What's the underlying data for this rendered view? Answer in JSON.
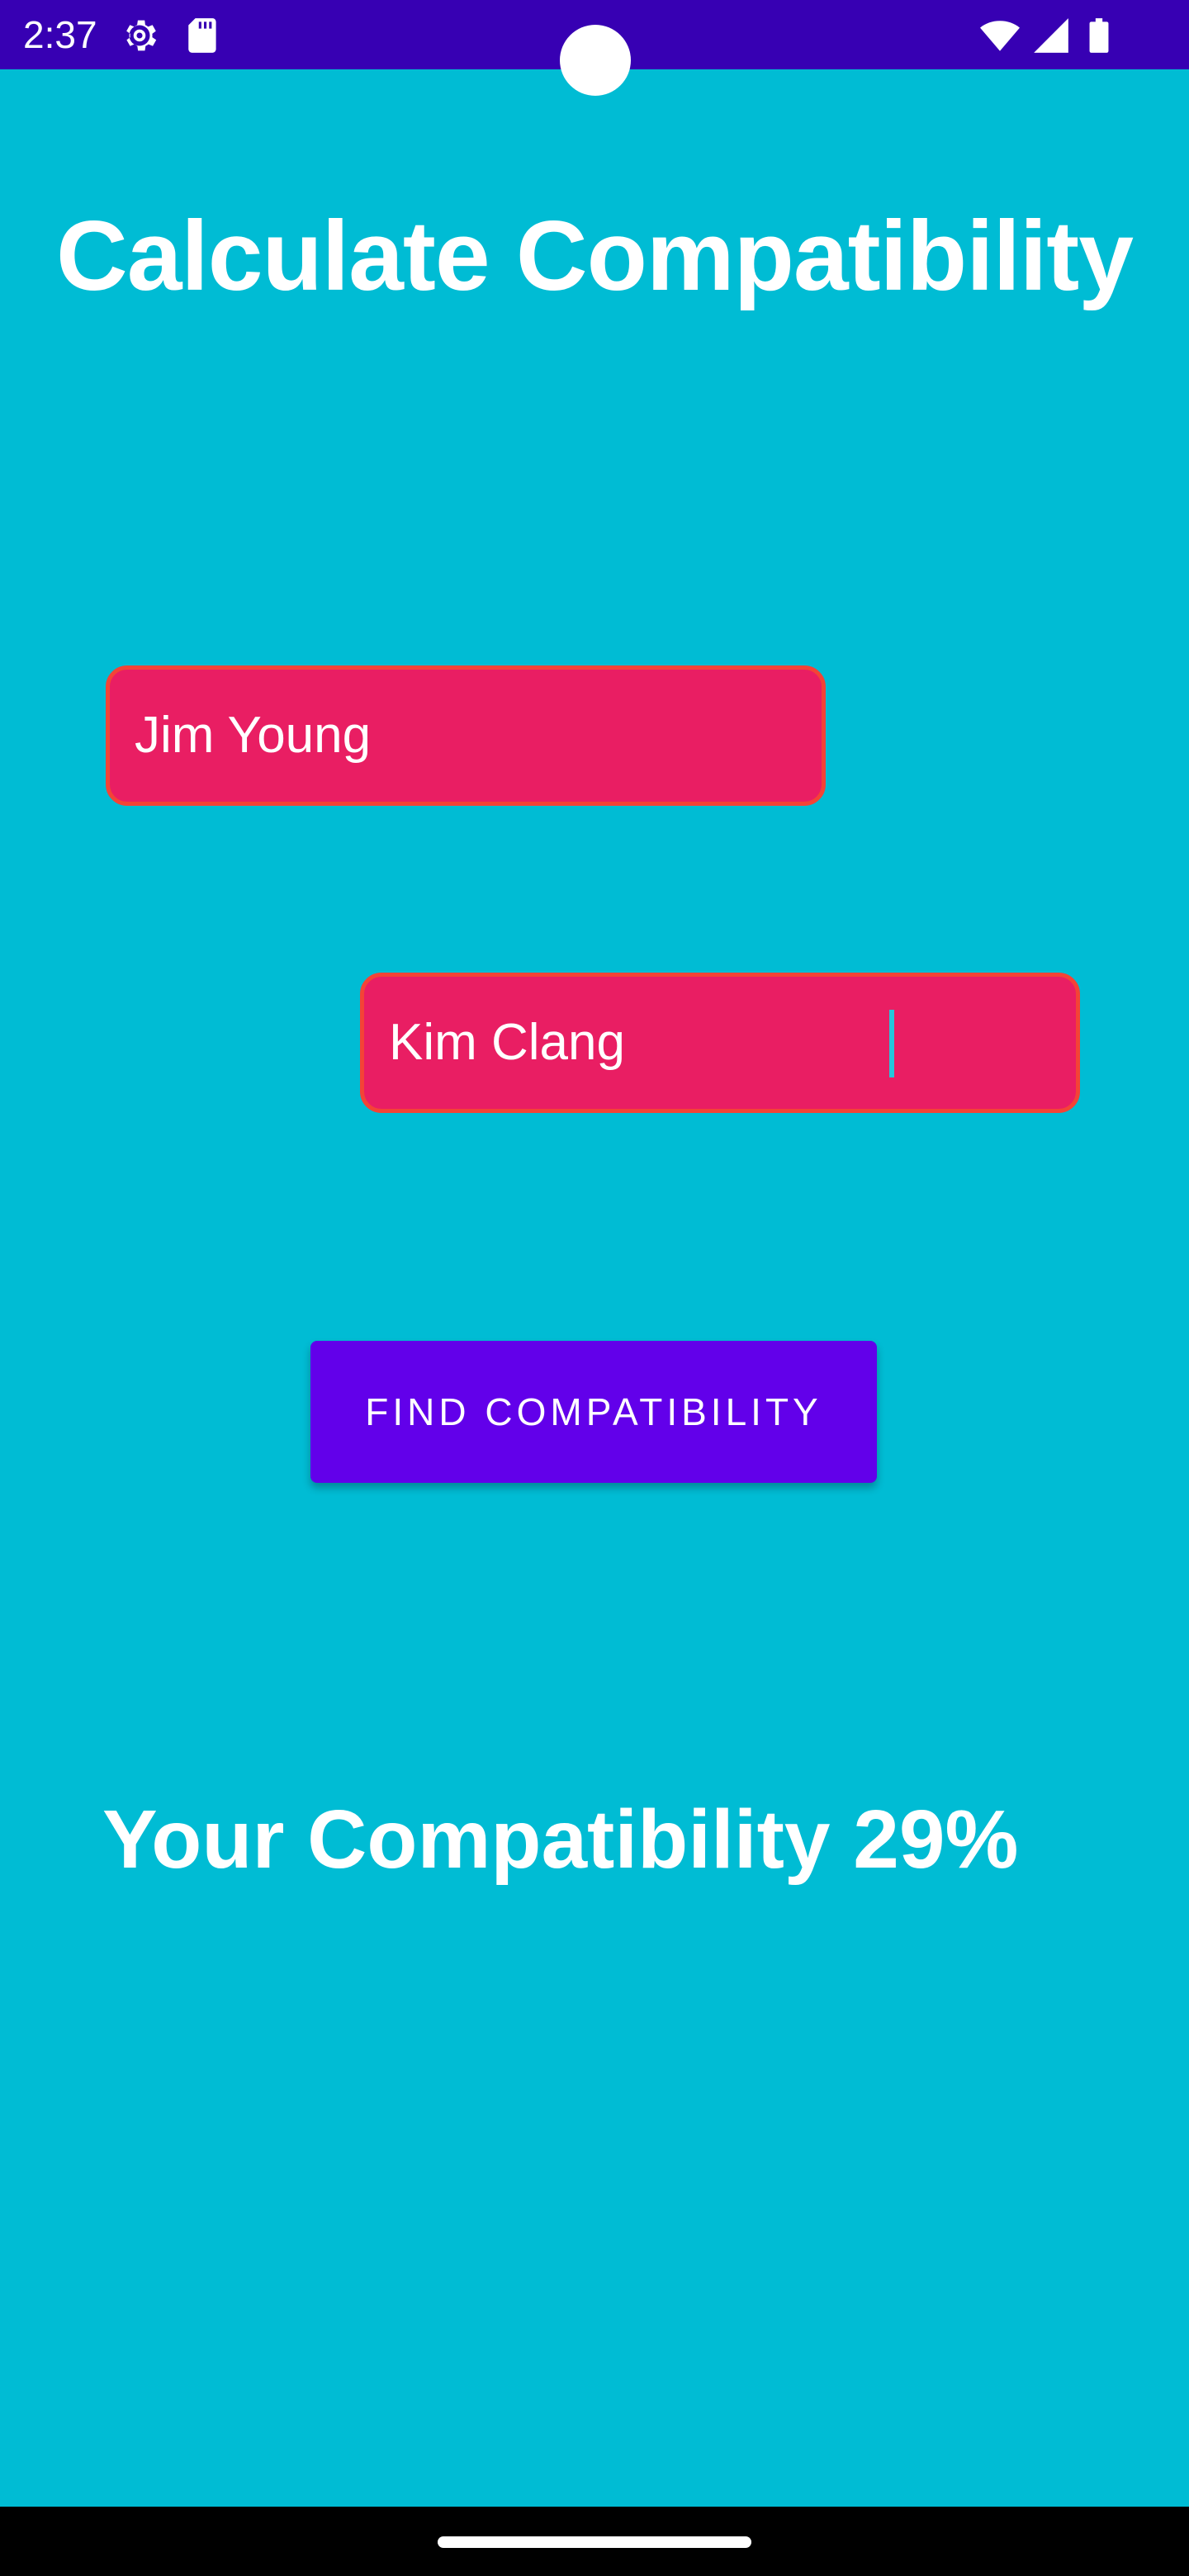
{
  "status_bar": {
    "time": "2:37",
    "icons": [
      "settings-icon",
      "sd-card-icon",
      "wifi-icon",
      "signal-icon",
      "battery-icon"
    ],
    "background": "#3700b3"
  },
  "app": {
    "title": "Calculate Compatibility",
    "background": "#00bcd4"
  },
  "inputs": {
    "name1_value": "Jim Young",
    "name2_value_before_cursor": "Kim C",
    "name2_value_after_cursor": "lang"
  },
  "button": {
    "label": "FIND COMPATIBILITY",
    "color": "#6200ea"
  },
  "result": {
    "text": "Your Compatibility 29%"
  },
  "colors": {
    "input_fill": "#e91e63",
    "input_border": "#f44336"
  }
}
